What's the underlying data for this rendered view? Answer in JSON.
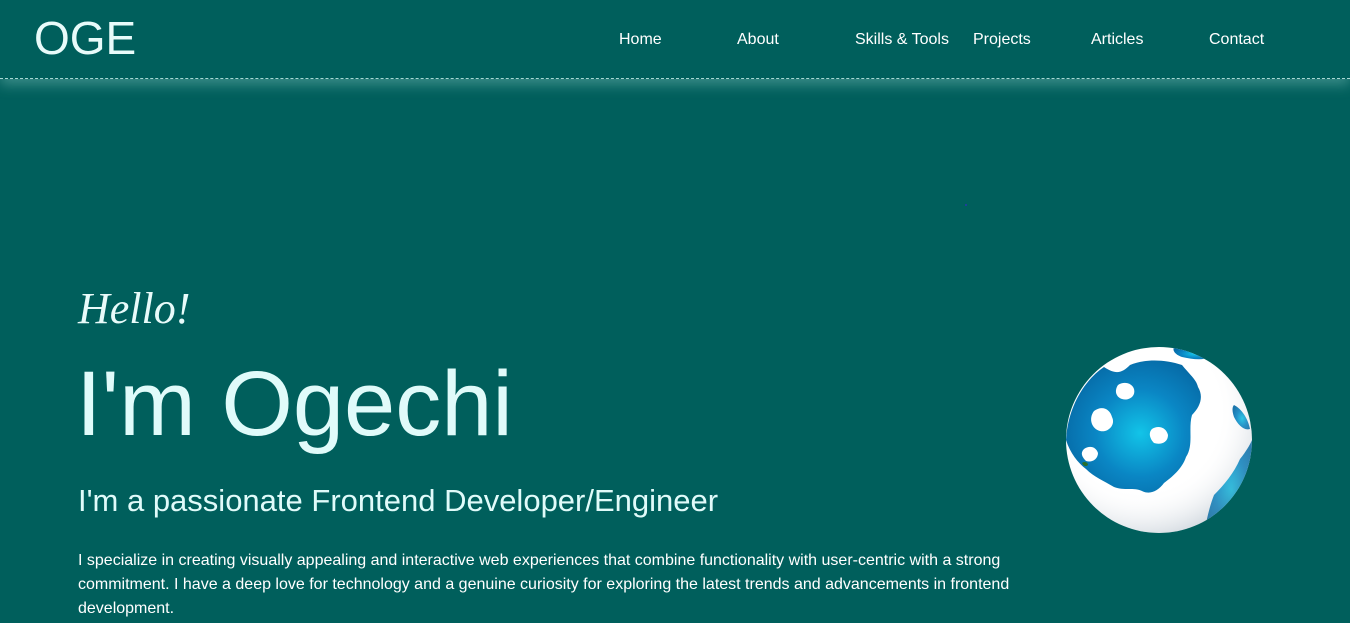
{
  "header": {
    "logo": "OGE",
    "nav": [
      {
        "label": "Home"
      },
      {
        "label": "About"
      },
      {
        "label": "Skills & Tools"
      },
      {
        "label": "Projects"
      },
      {
        "label": "Articles"
      },
      {
        "label": "Contact"
      }
    ]
  },
  "hero": {
    "greeting": "Hello!",
    "name": "I'm Ogechi",
    "role": "I'm a passionate Frontend Developer/Engineer",
    "description": "I specialize in creating visually appealing and interactive web experiences that combine functionality with user-centric with a strong commitment. I have a deep love for technology and a genuine curiosity for exploring the latest trends and advancements in frontend development.",
    "image": "globe-illustration"
  },
  "colors": {
    "background": "#005f5c",
    "text": "#e0fbfa",
    "globe_ocean": "#0a7fc0",
    "globe_land": "#ffffff"
  }
}
